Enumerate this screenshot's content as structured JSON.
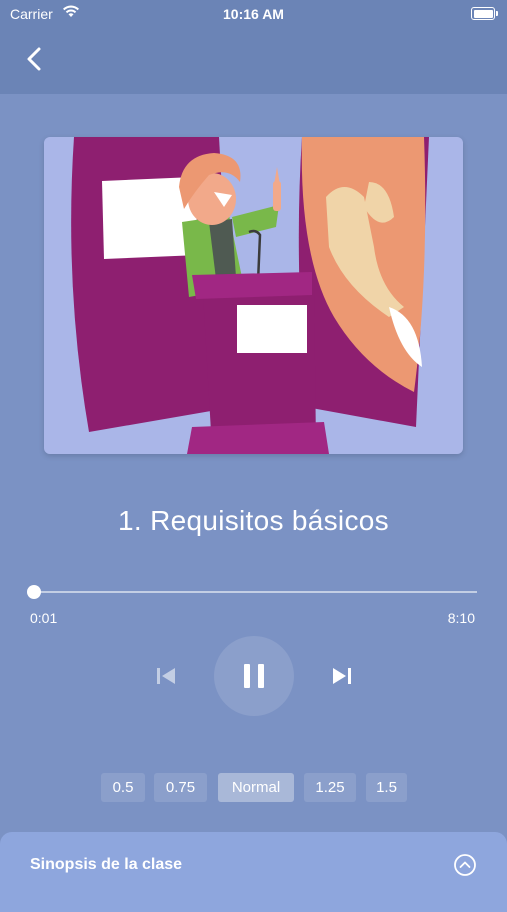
{
  "status_bar": {
    "carrier": "Carrier",
    "time": "10:16 AM"
  },
  "nav": {
    "back_icon": "chevron-left-icon"
  },
  "lesson": {
    "title": "1. Requisitos básicos"
  },
  "player": {
    "current_time": "0:01",
    "total_time": "8:10",
    "progress_fraction": 0.002,
    "controls": [
      "skip-previous-icon",
      "pause-icon",
      "skip-next-icon"
    ],
    "speed_options": [
      "0.5",
      "0.75",
      "Normal",
      "1.25",
      "1.5"
    ],
    "selected_speed": "Normal"
  },
  "synopsis": {
    "label": "Sinopsis de la clase",
    "toggle_icon": "chevron-up-circle-icon"
  },
  "colors": {
    "background": "#7b92c4",
    "header": "#6b84b6",
    "panel": "#8ea6dd",
    "illustration_magenta": "#8e1f70",
    "illustration_lavender": "#aab6e8"
  }
}
